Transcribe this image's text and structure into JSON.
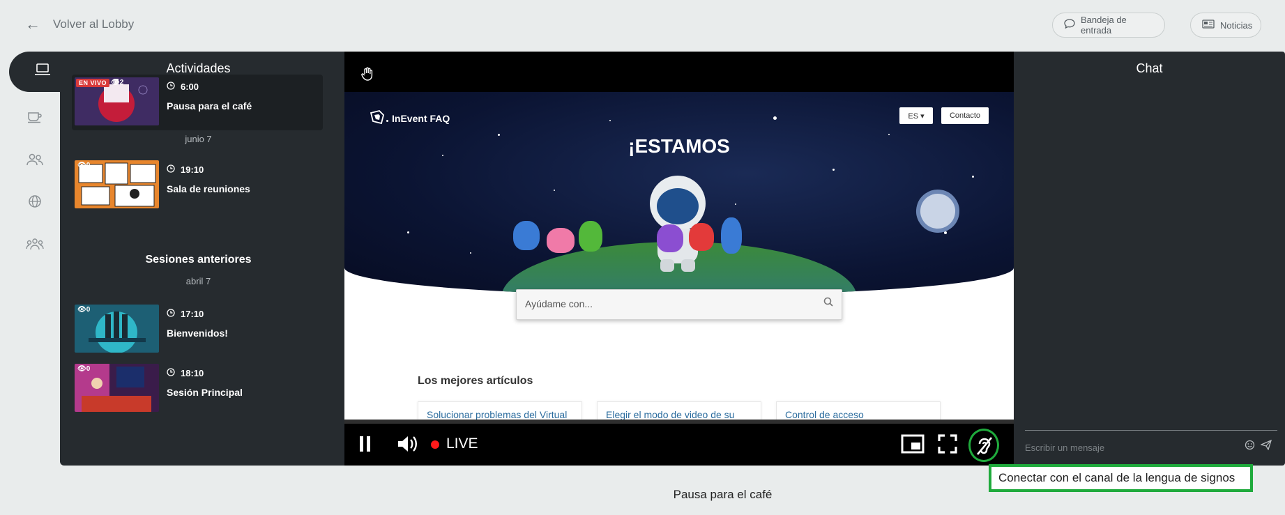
{
  "header": {
    "back_label": "Volver al Lobby",
    "inbox_label": "Bandeja de entrada",
    "news_label": "Noticias"
  },
  "sidebar": {
    "icons": [
      "laptop-icon",
      "coffee-icon",
      "users-icon",
      "globe-icon",
      "group-icon"
    ]
  },
  "activities": {
    "title": "Actividades",
    "live_badge": "EN VIVO",
    "items": [
      {
        "time": "6:00",
        "name": "Pausa para el café",
        "views": "2"
      },
      {
        "time": "19:10",
        "name": "Sala de reuniones",
        "views": "0"
      }
    ],
    "date_1": "junio 7",
    "previous_title": "Sesiones anteriores",
    "date_2": "abril 7",
    "previous": [
      {
        "time": "17:10",
        "name": "Bienvenidos!",
        "views": "0"
      },
      {
        "time": "18:10",
        "name": "Sesión Principal",
        "views": "0"
      }
    ]
  },
  "stream": {
    "logo": "InEvent FAQ",
    "lang_button": "ES ▾",
    "contact_button": "Contacto",
    "headline": "¡ESTAMOS",
    "search_placeholder": "Ayúdame con...",
    "articles_title": "Los mejores artículos",
    "articles": [
      "Solucionar problemas del Virtual Lobby",
      "Elegir el modo de video de su sala",
      "Control de acceso"
    ],
    "live_label": "LIVE"
  },
  "chat": {
    "title": "Chat",
    "input_placeholder": "Escribir un mensaje"
  },
  "tooltip": "Conectar con el canal de la lengua de signos",
  "caption": "Pausa para el café",
  "colors": {
    "panel": "#262b2f",
    "live": "#ff1a1a",
    "highlight": "#1faa3c"
  }
}
